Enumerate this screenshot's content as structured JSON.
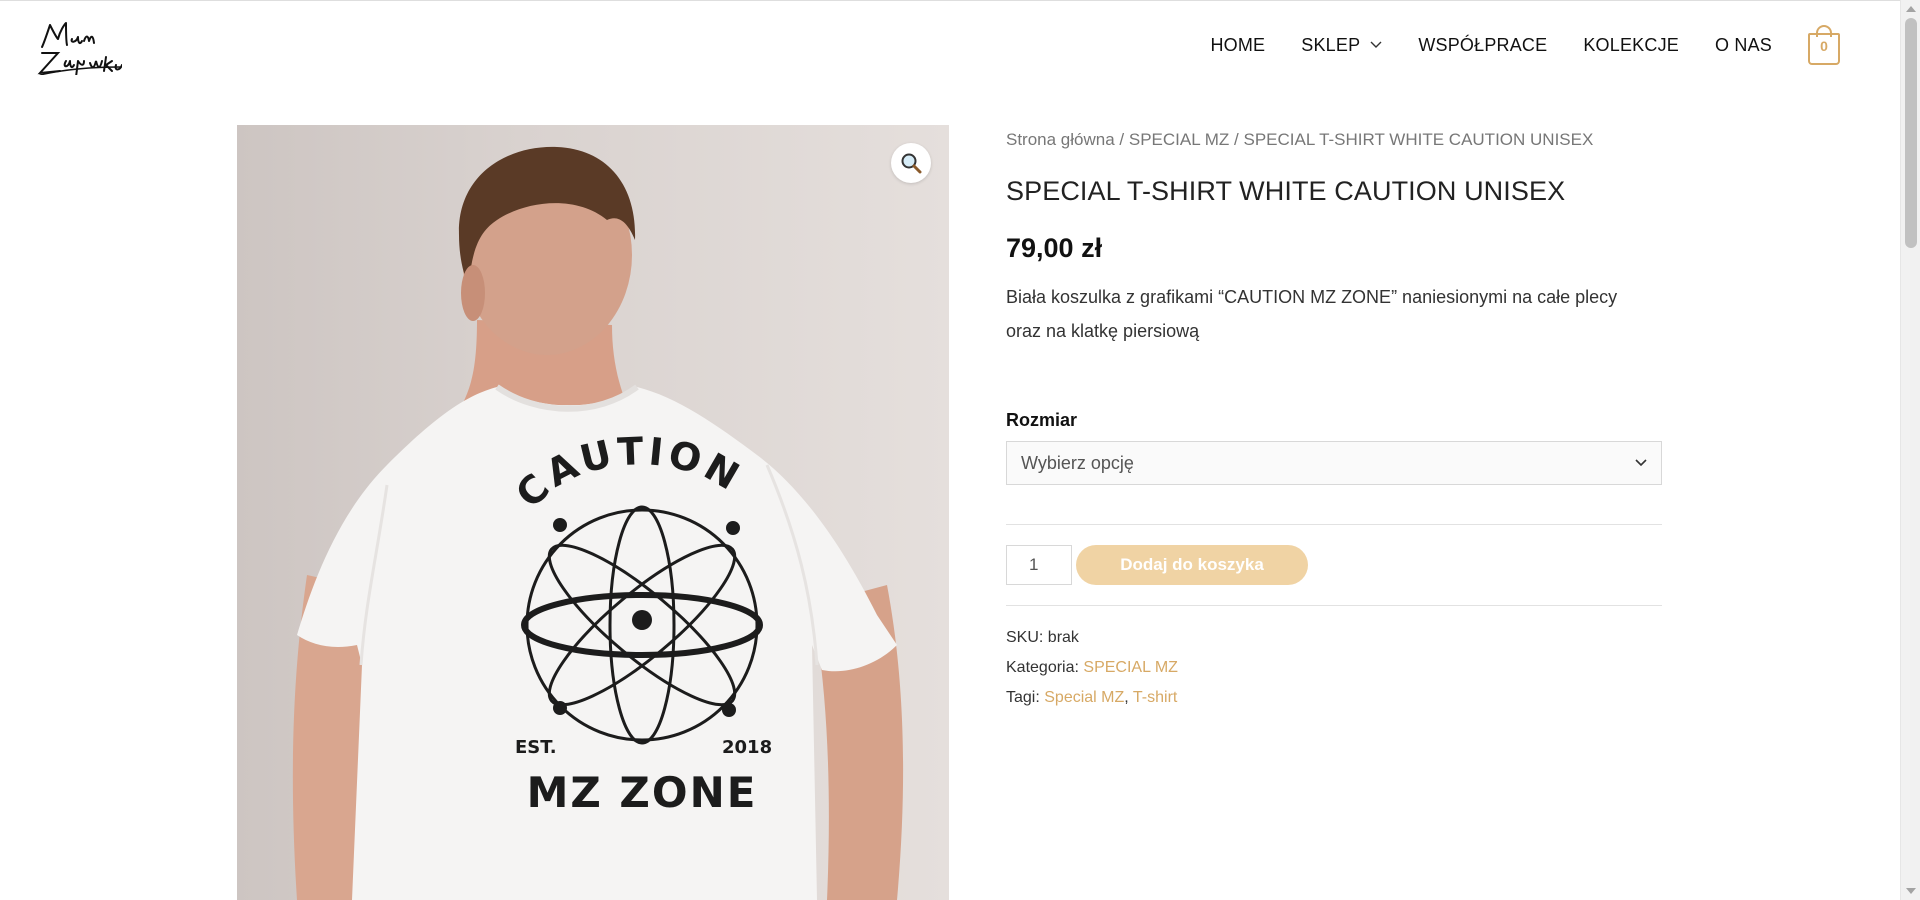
{
  "brand": {
    "logo_text": "Mam Zajawkę",
    "accent_color": "#d7a965",
    "button_color": "#f0d3a4"
  },
  "nav": {
    "items": [
      {
        "label": "HOME"
      },
      {
        "label": "SKLEP",
        "has_dropdown": true
      },
      {
        "label": "WSPÓŁPRACE"
      },
      {
        "label": "KOLEKCJE"
      },
      {
        "label": "O NAS"
      }
    ],
    "cart_count": "0"
  },
  "breadcrumb": {
    "home": "Strona główna",
    "sep1": " / ",
    "category": "SPECIAL MZ",
    "sep2": " / ",
    "current": "SPECIAL T-SHIRT WHITE CAUTION UNISEX"
  },
  "product": {
    "title": "SPECIAL T-SHIRT WHITE CAUTION UNISEX",
    "price": "79,00 zł",
    "description": "Biała koszulka z grafikami “CAUTION MZ ZONE” naniesionymi na całe plecy oraz na klatkę piersiową",
    "size_label": "Rozmiar",
    "size_placeholder": "Wybierz opcję",
    "quantity": "1",
    "add_to_cart": "Dodaj do koszyka",
    "sku_label": "SKU:",
    "sku_value": "brak",
    "category_label": "Kategoria:",
    "category_value": "SPECIAL MZ",
    "tags_label": "Tagi:",
    "tags": [
      "Special MZ",
      "T-shirt"
    ],
    "tag_sep": ", "
  },
  "image": {
    "print_top": "CAUTION",
    "print_est": "EST.",
    "print_year": "2018",
    "print_bottom": "MZ ZONE"
  },
  "icons": {
    "zoom": "magnifier-icon",
    "cart": "shopping-bag-icon",
    "chevron": "chevron-down-icon"
  }
}
